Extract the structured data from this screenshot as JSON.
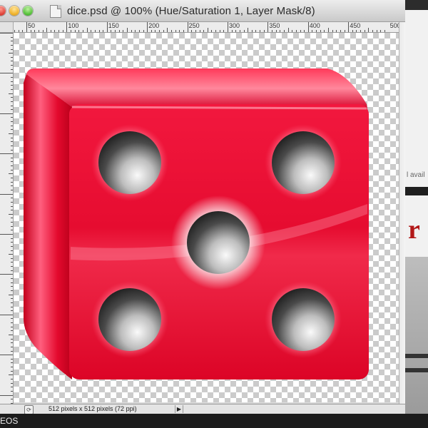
{
  "window": {
    "title": "dice.psd @ 100% (Hue/Saturation 1, Layer Mask/8)"
  },
  "ruler": {
    "labels": [
      "50",
      "100",
      "150",
      "200",
      "250",
      "300",
      "350",
      "400",
      "450",
      "500"
    ]
  },
  "status_bar": {
    "doc_info": "512 pixels x 512 pixels (72 ppi)"
  },
  "background_app": {
    "partial_text": "l avail",
    "red_glyph": "r"
  },
  "bottom_bar": {
    "partial_text": "EOS"
  },
  "colors": {
    "die_red": "#e8092d",
    "pip_gray": "#4a4a4a"
  },
  "canvas": {
    "content": "red-die-showing-five",
    "pips": 5
  }
}
